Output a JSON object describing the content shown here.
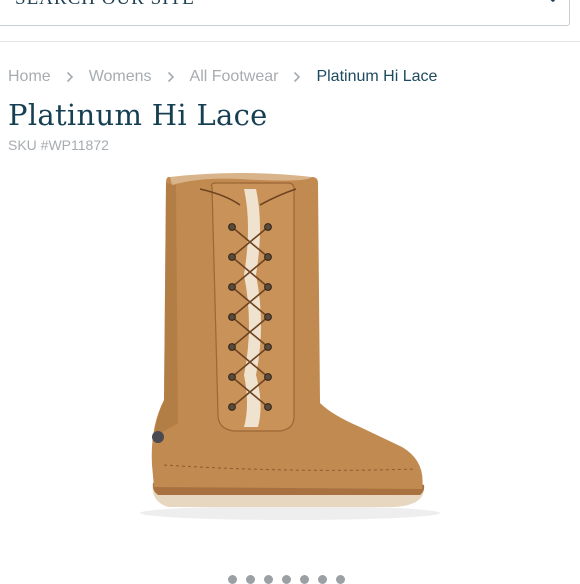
{
  "search": {
    "placeholder": "SEARCH OUR SITE",
    "icon": "search-icon"
  },
  "breadcrumb": {
    "items": [
      "Home",
      "Womens",
      "All Footwear"
    ],
    "current": "Platinum Hi Lace"
  },
  "product": {
    "title": "Platinum Hi Lace",
    "sku": "SKU #WP11872",
    "image_icon": "boot-image"
  },
  "carousel": {
    "dot_count": 7
  },
  "colors": {
    "brand_text": "#173f53",
    "muted_text": "#a7acb0",
    "border": "#c9ced2",
    "boot_tan": "#c18a50"
  }
}
